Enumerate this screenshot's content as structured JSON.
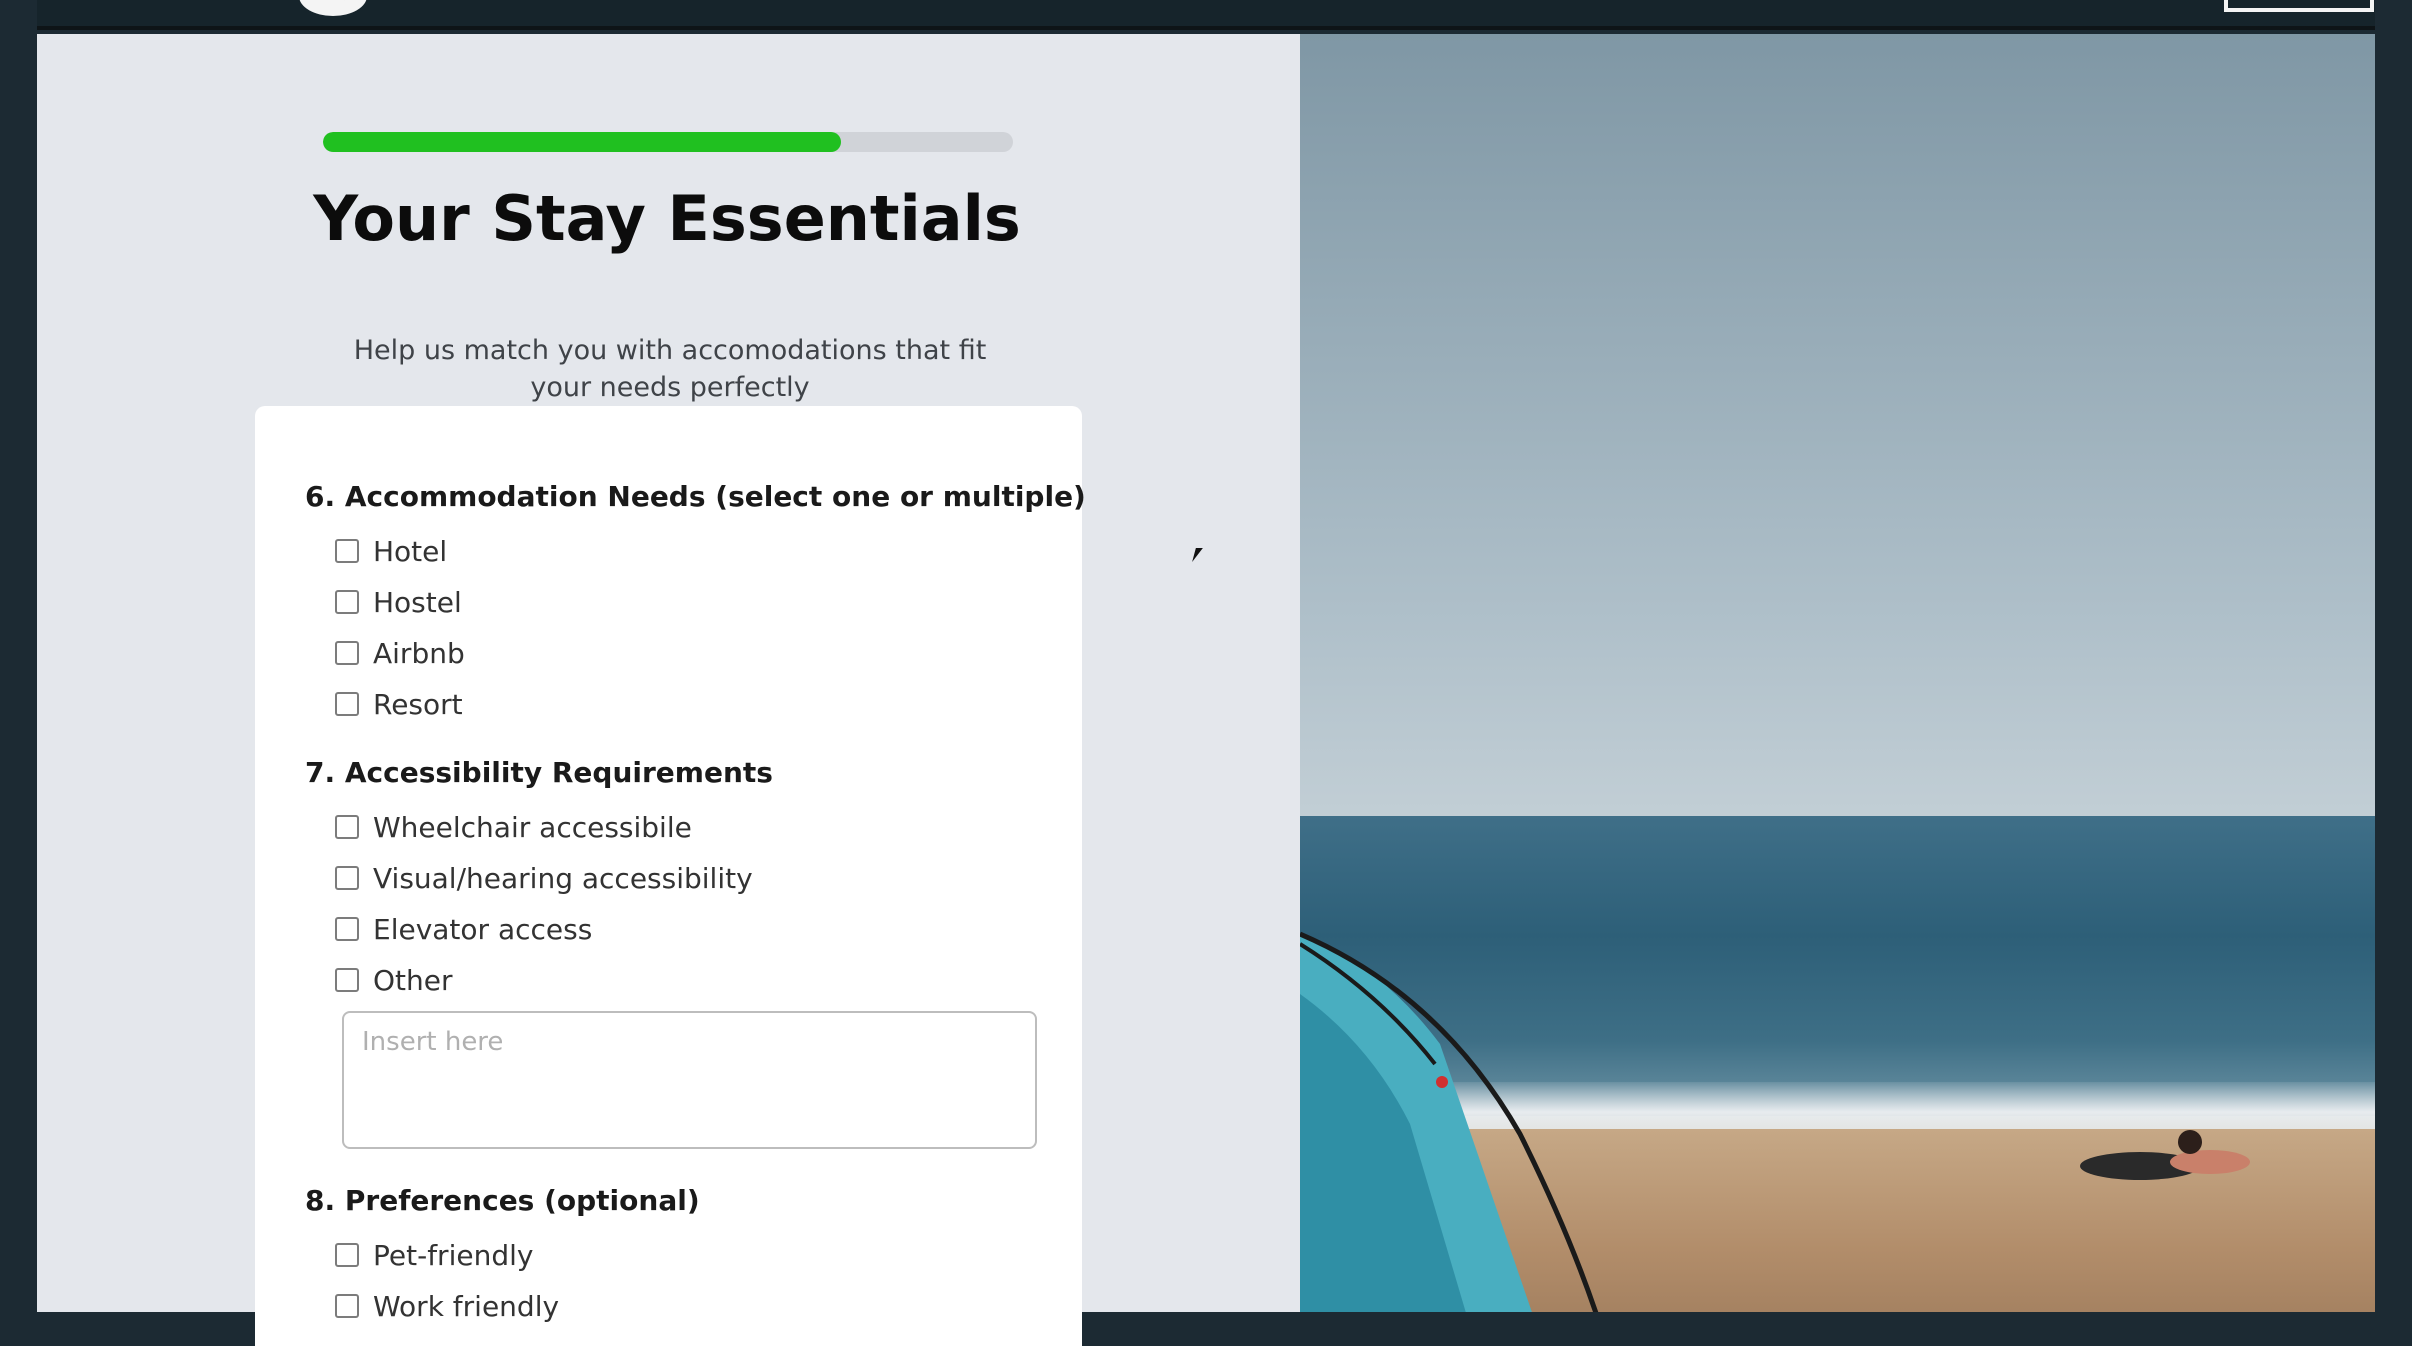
{
  "progress": {
    "value": 0.75
  },
  "header": {
    "title": "Your Stay Essentials",
    "subtitle": "Help us match you with accomodations that fit your needs perfectly"
  },
  "form": {
    "questions": [
      {
        "title": "6. Accommodation Needs (select one or multiple)",
        "options": [
          "Hotel",
          "Hostel",
          "Airbnb",
          "Resort"
        ]
      },
      {
        "title": "7. Accessibility Requirements",
        "options": [
          "Wheelchair accessibile",
          "Visual/hearing accessibility",
          "Elevator access",
          "Other"
        ],
        "other_input": {
          "placeholder": "Insert here",
          "value": ""
        }
      },
      {
        "title": "8. Preferences (optional)",
        "options": [
          "Pet-friendly",
          "Work friendly"
        ]
      }
    ]
  },
  "colors": {
    "progress_fill": "#20c020",
    "panel_bg": "#e4e7ec",
    "card_bg": "#ffffff"
  }
}
